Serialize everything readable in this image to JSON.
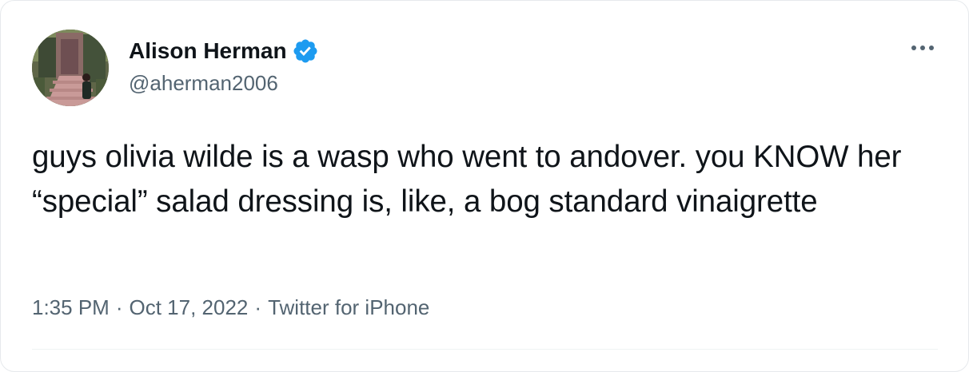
{
  "author": {
    "display_name": "Alison Herman",
    "handle": "@aherman2006",
    "verified": true,
    "avatar_icon": "profile-photo"
  },
  "tweet": {
    "text": "guys olivia wilde is a wasp who went to andover. you KNOW her “special” salad dressing is, like, a bog standard vinaigrette"
  },
  "meta": {
    "time": "1:35 PM",
    "separator": "·",
    "date": "Oct 17, 2022",
    "source": "Twitter for iPhone"
  },
  "icons": {
    "more": "more-horizontal-icon",
    "verified": "verified-badge-icon"
  },
  "colors": {
    "text": "#0f1419",
    "secondary": "#536471",
    "verified_blue": "#1d9bf0",
    "divider": "#eff3f4"
  }
}
